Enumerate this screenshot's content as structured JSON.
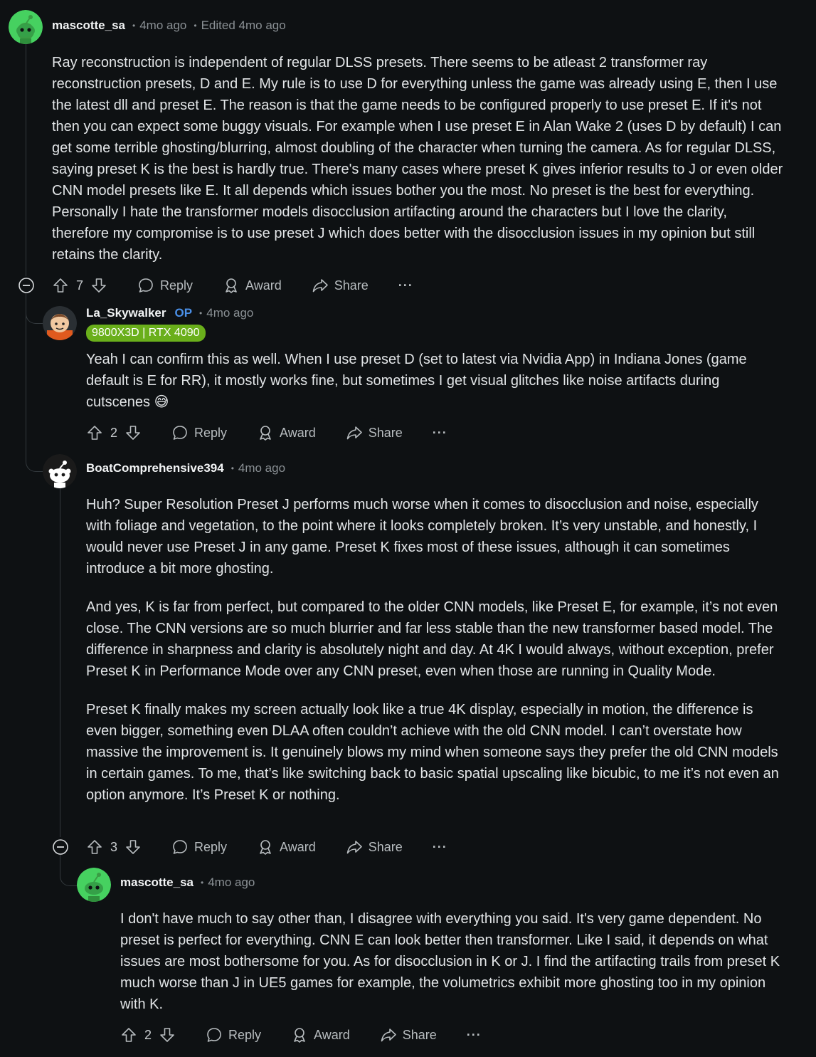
{
  "comments": [
    {
      "username": "mascotte_sa",
      "time": "4mo ago",
      "edited": "Edited 4mo ago",
      "body": [
        "Ray reconstruction is independent of regular DLSS presets. There seems to be atleast 2 transformer ray reconstruction presets, D and E. My rule is to use D for everything unless the game was already using E, then I use the latest dll and preset E. The reason is that the game needs to be configured properly to use preset E. If it's not then you can expect some buggy visuals. For example when I use preset E in Alan Wake 2 (uses D by default) I can get some terrible ghosting/blurring, almost doubling of the character when turning the camera. As for regular DLSS, saying preset K is the best is hardly true. There's many cases where preset K gives inferior results to J or even older CNN model presets like E. It all depends which issues bother you the most. No preset is the best for everything. Personally I hate the transformer models disocclusion artifacting around the characters but I love the clarity, therefore my compromise is to use preset J which does better with the disocclusion issues in my opinion but still retains the clarity."
      ],
      "votes": "7"
    },
    {
      "username": "La_Skywalker",
      "op_badge": "OP",
      "time": "4mo ago",
      "flair": "9800X3D | RTX 4090",
      "body": [
        "Yeah I can confirm this as well. When I use preset D (set to latest via Nvidia App) in Indiana Jones (game default is E for RR), it mostly works fine, but sometimes I get visual glitches like noise artifacts during cutscenes"
      ],
      "emoji": "😅",
      "votes": "2"
    },
    {
      "username": "BoatComprehensive394",
      "time": "4mo ago",
      "body": [
        "Huh? Super Resolution Preset J performs much worse when it comes to disocclusion and noise, especially with foliage and vegetation, to the point where it looks completely broken. It’s very unstable, and honestly, I would never use Preset J in any game. Preset K fixes most of these issues, although it can sometimes introduce a bit more ghosting.",
        "And yes, K is far from perfect, but compared to the older CNN models, like Preset E, for example, it’s not even close. The CNN versions are so much blurrier and far less stable than the new transformer based model. The difference in sharpness and clarity is absolutely night and day. At 4K I would always, without exception, prefer Preset K in Performance Mode over any CNN preset, even when those are running in Quality Mode.",
        "Preset K finally makes my screen actually look like a true 4K display, especially in motion, the difference is even bigger, something even DLAA often couldn’t achieve with the old CNN model. I can’t overstate how massive the improvement is. It genuinely blows my mind when someone says they prefer the old CNN models in certain games. To me, that’s like switching back to basic spatial upscaling like bicubic, to me it’s not even an option anymore. It’s Preset K or nothing."
      ],
      "votes": "3"
    },
    {
      "username": "mascotte_sa",
      "time": "4mo ago",
      "body": [
        "I don't have much to say other than, I disagree with everything you said. It's very game dependent. No preset is perfect for everything. CNN E can look better then transformer. Like I said, it depends on what issues are most bothersome for you. As for disocclusion in K or J. I find the artifacting trails from preset K much worse than J in UE5 games for example, the volumetrics exhibit more ghosting too in my opinion with K."
      ],
      "votes": "2"
    }
  ],
  "actions": {
    "reply": "Reply",
    "award": "Award",
    "share": "Share",
    "more": "···"
  },
  "separator": "•",
  "colors": {
    "background": "#0e1113",
    "op": "#4a8fe7",
    "flair": "#6aaf1b",
    "avatar_green": "#46d160"
  }
}
